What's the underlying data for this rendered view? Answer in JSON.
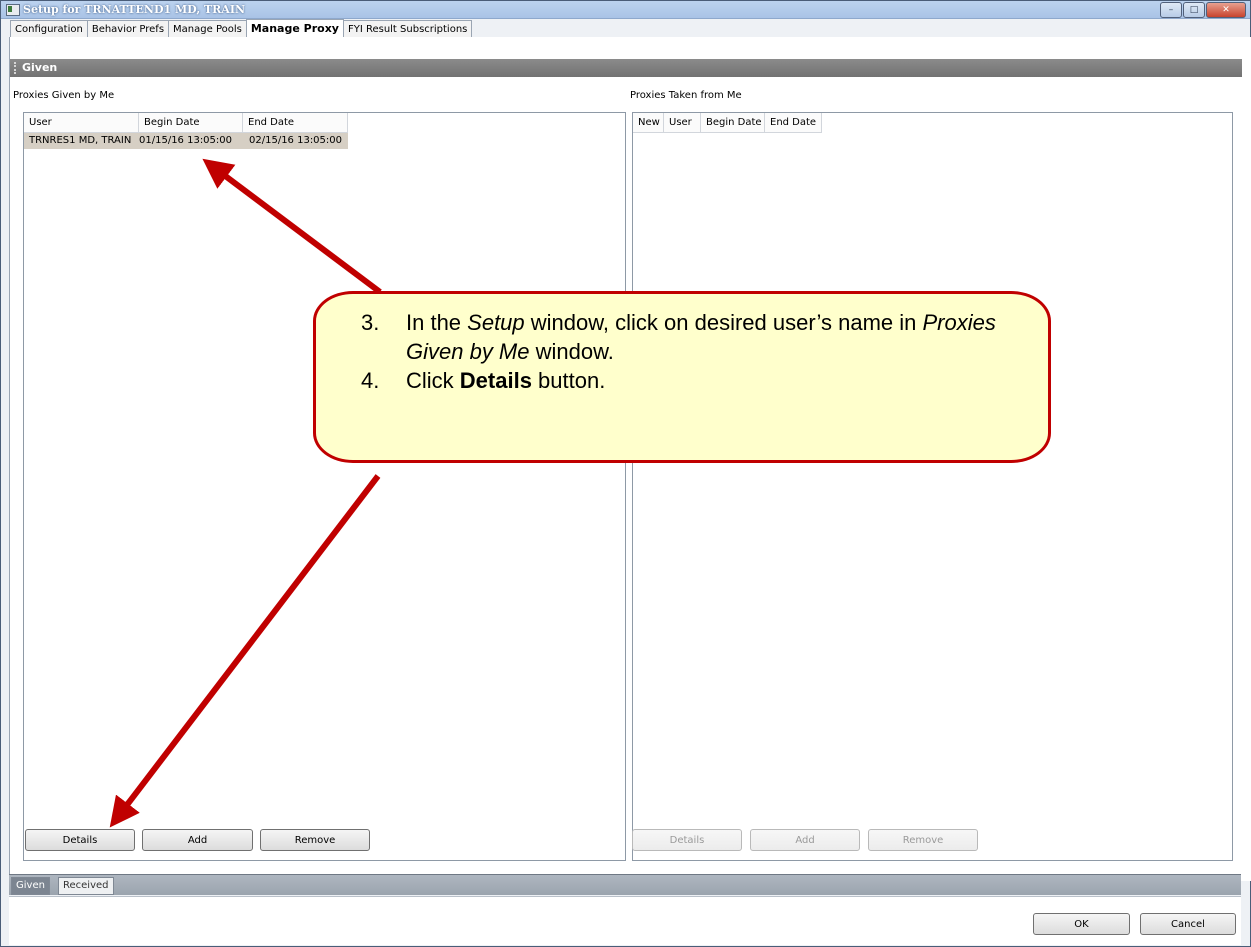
{
  "window": {
    "title": "Setup for TRNATTEND1 MD, TRAIN",
    "controls": {
      "minimize": "–",
      "maximize": "□",
      "close": "✕"
    }
  },
  "tabs": [
    {
      "label": "Configuration",
      "active": false
    },
    {
      "label": "Behavior Prefs",
      "active": false
    },
    {
      "label": "Manage Pools",
      "active": false
    },
    {
      "label": "Manage Proxy",
      "active": true
    },
    {
      "label": "FYI Result Subscriptions",
      "active": false
    }
  ],
  "section": {
    "title": "Given"
  },
  "given_pane": {
    "label": "Proxies Given by Me",
    "columns": [
      "User",
      "Begin Date",
      "End Date"
    ],
    "rows": [
      {
        "user": "TRNRES1 MD, TRAIN",
        "begin": "01/15/16 13:05:00",
        "end": "02/15/16 13:05:00",
        "selected": true
      }
    ],
    "buttons": {
      "details": "Details",
      "add": "Add",
      "remove": "Remove"
    }
  },
  "taken_pane": {
    "label": "Proxies Taken from Me",
    "columns": [
      "New",
      "User",
      "Begin Date",
      "End Date"
    ],
    "buttons": {
      "details": "Details",
      "add": "Add",
      "remove": "Remove"
    }
  },
  "bottom_tabs": [
    {
      "label": "Given",
      "active": true
    },
    {
      "label": "Received",
      "active": false
    }
  ],
  "footer": {
    "ok": "OK",
    "cancel": "Cancel"
  },
  "callout": {
    "step3_num": "3.",
    "step3_pre": "In the ",
    "step3_em1": "Setup",
    "step3_mid": " window, click on desired user’s name in ",
    "step3_em2": "Proxies Given by Me",
    "step3_post": " window.",
    "step4_num": "4.",
    "step4_pre": "Click ",
    "step4_bold": "Details",
    "step4_post": " button."
  },
  "colors": {
    "annotation_red": "#c00000",
    "callout_fill": "#ffffcc",
    "selected_row": "#d6cfc4",
    "section_bar": "#7d7d7d"
  }
}
